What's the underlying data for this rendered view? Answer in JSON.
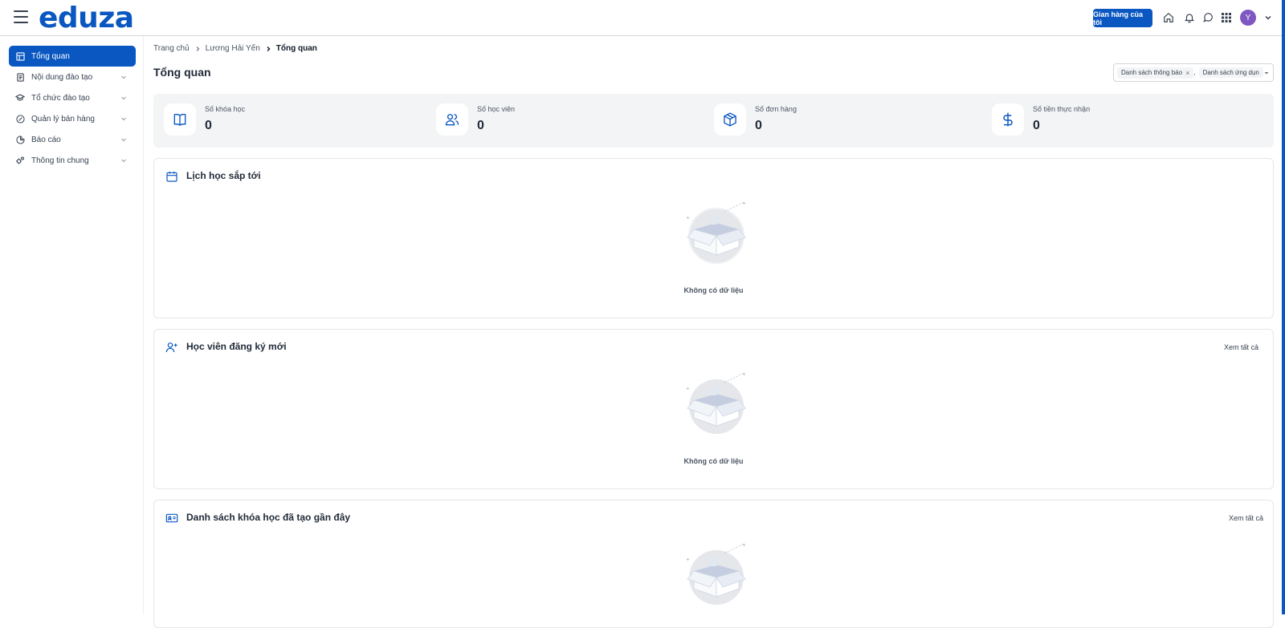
{
  "header": {
    "logo": "eduza",
    "store_button": "Gian hàng của tôi",
    "avatar_initial": "Y",
    "brand_color": "#0a57c2"
  },
  "sidebar": {
    "items": [
      {
        "label": "Tổng quan",
        "icon": "dashboard-icon"
      },
      {
        "label": "Nội dung đào tạo",
        "icon": "document-icon"
      },
      {
        "label": "Tổ chức đào tạo",
        "icon": "graduation-cap-icon"
      },
      {
        "label": "Quản lý bán hàng",
        "icon": "sales-icon"
      },
      {
        "label": "Báo cáo",
        "icon": "chart-pie-icon"
      },
      {
        "label": "Thông tin chung",
        "icon": "settings-icon"
      }
    ]
  },
  "breadcrumb": {
    "home": "Trang chủ",
    "parent": "Lương Hải Yến",
    "current": "Tổng quan"
  },
  "page_title": "Tổng quan",
  "widget_select": {
    "tag1": "Danh sách thông báo",
    "separator": ",",
    "tag2": "Danh sách ứng dụn"
  },
  "stats": [
    {
      "label": "Số khóa học",
      "value": "0",
      "icon": "book-icon"
    },
    {
      "label": "Số học viên",
      "value": "0",
      "icon": "users-icon"
    },
    {
      "label": "Số đơn hàng",
      "value": "0",
      "icon": "box-icon"
    },
    {
      "label": "Số tiền thực nhận",
      "value": "0",
      "icon": "dollar-icon"
    }
  ],
  "cards": {
    "schedule": {
      "title": "Lịch học sắp tới",
      "empty": "Không có dữ liệu"
    },
    "new_students": {
      "title": "Học viên đăng ký mới",
      "link": "Xem tất cả",
      "empty": "Không có dữ liệu"
    },
    "recent_courses": {
      "title": "Danh sách khóa học đã tạo gần đây",
      "link": "Xem tất cả"
    }
  }
}
